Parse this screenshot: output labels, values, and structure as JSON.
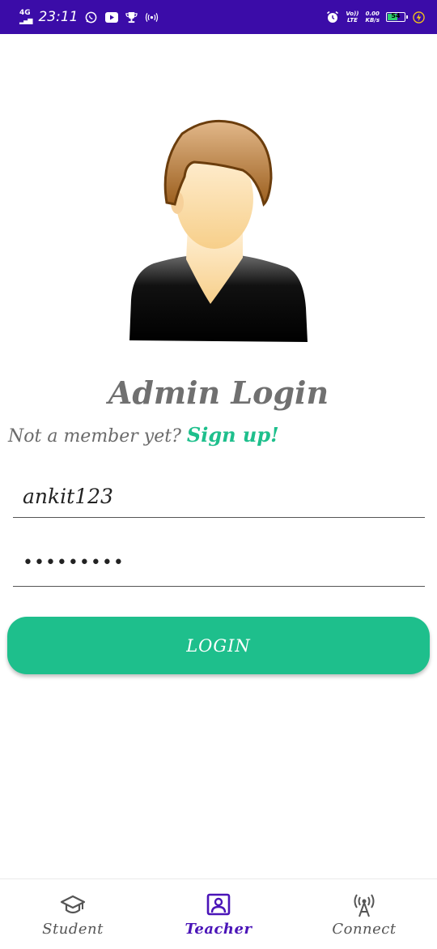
{
  "status_bar": {
    "network": "4G",
    "time": "23:11",
    "volte_top": "Vo))",
    "volte_bottom": "LTE",
    "speed_top": "0.00",
    "speed_bottom": "KB/s",
    "battery_level": "54",
    "colors": {
      "background": "#3b0ca8"
    }
  },
  "login": {
    "title": "Admin Login",
    "signup_prompt": "Not a member yet?",
    "signup_link": "Sign up!",
    "username_value": "ankit123",
    "password_value": "•••••••••",
    "login_label": "LOGIN"
  },
  "bottom_nav": {
    "items": [
      {
        "label": "Student",
        "icon": "graduation-cap-icon",
        "active": false
      },
      {
        "label": "Teacher",
        "icon": "teacher-board-icon",
        "active": true
      },
      {
        "label": "Connect",
        "icon": "broadcast-tower-icon",
        "active": false
      }
    ]
  },
  "colors": {
    "accent": "#1ebf8c",
    "active_nav": "#4a14b8",
    "title_gray": "#707070"
  }
}
